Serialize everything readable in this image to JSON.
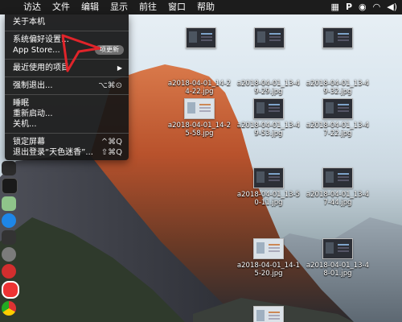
{
  "menubar": {
    "apple_icon": "",
    "items": [
      {
        "label": "访达"
      },
      {
        "label": "文件"
      },
      {
        "label": "编辑"
      },
      {
        "label": "显示"
      },
      {
        "label": "前往"
      },
      {
        "label": "窗口"
      },
      {
        "label": "帮助"
      }
    ],
    "tray_icons": [
      "grid-icon",
      "p-icon",
      "wechat-icon",
      "wifi-icon",
      "volume-icon"
    ]
  },
  "apple_menu": {
    "about": "关于本机",
    "system_prefs": "系统偏好设置…",
    "app_store": "App Store...",
    "app_store_badge": "项更新",
    "recent_items": "最近使用的项目",
    "recent_arrow": "▶",
    "force_quit": "强制退出...",
    "force_quit_shortcut": "⌥⌘⊙",
    "sleep": "睡眠",
    "restart": "重新启动...",
    "shutdown": "关机...",
    "lock_screen": "锁定屏幕",
    "lock_screen_shortcut": "^⌘Q",
    "log_out": "退出登录“天色迷香”...",
    "log_out_shortcut": "⇧⌘Q"
  },
  "files": [
    {
      "name": "",
      "variant": "dark"
    },
    {
      "name": "",
      "variant": "dark"
    },
    {
      "name": "",
      "variant": "dark"
    },
    {
      "name": "a2018-04-01_14-2\n4-22.jpg",
      "variant": "empty"
    },
    {
      "name": "a2018-04-01_13-4\n9-29.jpg",
      "variant": "empty"
    },
    {
      "name": "a2018-04-01_13-4\n9-32.jpg",
      "variant": "empty"
    },
    {
      "name": "a2018-04-01_14-2\n5-58.jpg",
      "variant": "light"
    },
    {
      "name": "a2018-04-01_13-4\n9-53.jpg",
      "variant": "dark"
    },
    {
      "name": "a2018-04-01_13-4\n7-22.jpg",
      "variant": "dark"
    },
    {
      "name": "a2018-04-01_13-5\n0-11.jpg",
      "variant": "dark"
    },
    {
      "name": "a2018-04-01_13-4\n7-44.jpg",
      "variant": "dark"
    },
    {
      "name": "a2018-04-01_14-1\n5-20.jpg",
      "variant": "light"
    },
    {
      "name": "a2018-04-01_13-4\n8-01.jpg",
      "variant": "dark"
    }
  ],
  "colors": {
    "menubar_bg": "#1c1c1c",
    "menu_bg": "#161616",
    "annotation_red": "#e0242a"
  }
}
